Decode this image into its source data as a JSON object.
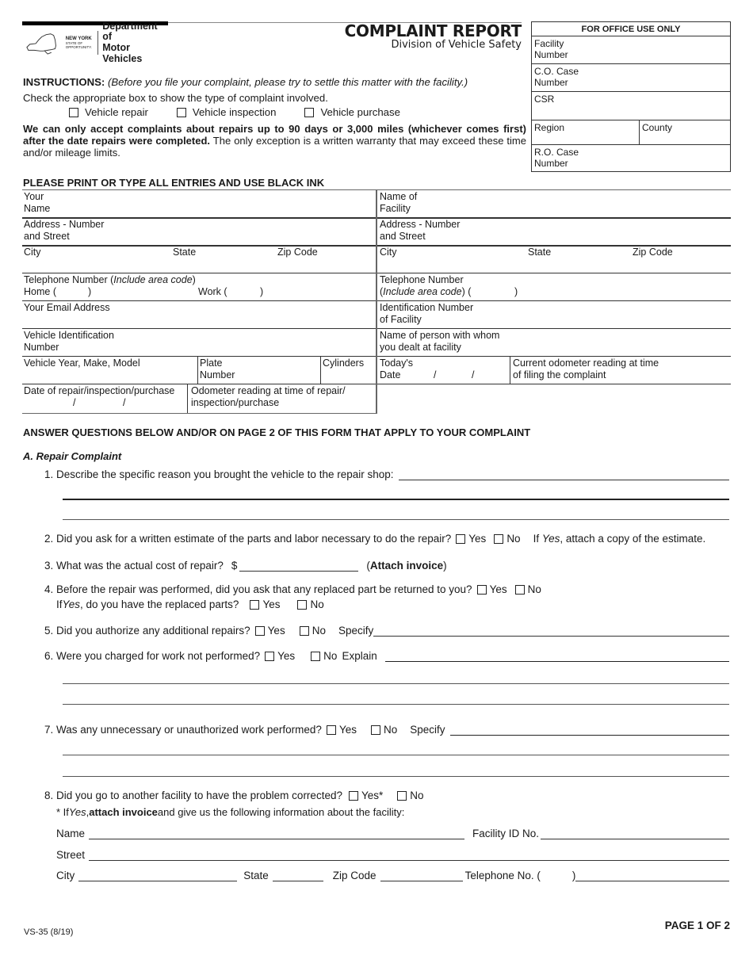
{
  "header": {
    "logo": {
      "state_name": "NEW YORK",
      "state_tagline": "STATE OF OPPORTUNITY.",
      "dept_line1": "Department of",
      "dept_line2": "Motor Vehicles"
    },
    "title": "COMPLAINT REPORT",
    "subtitle": "Division of Vehicle Safety"
  },
  "office_use": {
    "heading": "FOR OFFICE USE ONLY",
    "facility_number_1": "Facility",
    "facility_number_2": "Number",
    "co_case_1": "C.O. Case",
    "co_case_2": "Number",
    "csr": "CSR",
    "region": "Region",
    "county": "County",
    "ro_case_1": "R.O. Case",
    "ro_case_2": "Number"
  },
  "instructions": {
    "label": "INSTRUCTIONS:",
    "note": "(Before you file your complaint, please try to settle this matter with the facility.)",
    "check_prompt": "Check the appropriate box to show the type of complaint involved.",
    "complaint_types": [
      "Vehicle repair",
      "Vehicle inspection",
      "Vehicle purchase"
    ],
    "limits_bold": "We can only accept complaints about repairs up to 90 days or 3,000 miles (whichever comes first) after the date repairs were completed.",
    "limits_rest": " The only exception is a written warranty that may exceed these time and/or mileage limits."
  },
  "form": {
    "print_notice": "PLEASE PRINT OR TYPE ALL ENTRIES AND USE BLACK INK",
    "left": {
      "your_name_1": "Your",
      "your_name_2": "Name",
      "address_1": "Address - Number",
      "address_2": "and Street",
      "city": "City",
      "state": "State",
      "zip": "Zip Code",
      "phone_1": "Telephone Number (",
      "phone_italic": "Include area code",
      "phone_end": ")",
      "home": "Home (",
      "home_close": ")",
      "work": "Work (",
      "work_close": ")",
      "email": "Your Email Address",
      "vin_1": "Vehicle Identification",
      "vin_2": "Number",
      "vehicle_ymm": "Vehicle Year, Make, Model",
      "plate_1": "Plate",
      "plate_2": "Number",
      "cylinders": "Cylinders",
      "date_repair": "Date of repair/inspection/purchase",
      "date_sep": "/",
      "odometer_1": "Odometer reading at time of repair/",
      "odometer_2": "inspection/purchase"
    },
    "right": {
      "facility_name_1": "Name of",
      "facility_name_2": "Facility",
      "address_1": "Address - Number",
      "address_2": "and Street",
      "city": "City",
      "state": "State",
      "zip": "Zip Code",
      "phone_1": "Telephone Number",
      "phone_italic": "Include area code",
      "phone_paren": ") (",
      "phone_close": ")",
      "id_1": "Identification Number",
      "id_2": "of Facility",
      "person_1": "Name of person with whom",
      "person_2": "you dealt at facility",
      "today_1": "Today's",
      "today_2": "Date",
      "date_sep": "/",
      "current_odo_1": "Current odometer reading at time",
      "current_odo_2": "of filing the complaint"
    }
  },
  "questions": {
    "heading": "ANSWER QUESTIONS BELOW AND/OR ON PAGE 2 OF THIS FORM THAT APPLY TO YOUR COMPLAINT",
    "section_a": "A. Repair Complaint",
    "yes": "Yes",
    "no": "No",
    "q1": "1. Describe the specific reason you brought the vehicle to the repair shop:",
    "q2": "2. Did you ask for a written estimate of the parts and labor necessary to do the repair?",
    "q2_note_pre": "If ",
    "q2_note_yes": "Yes",
    "q2_note_post": ", attach a copy of the estimate.",
    "q3": "3. What was the actual cost of repair?",
    "q3_currency": "$",
    "q3_attach_open": "(",
    "q3_attach": "Attach invoice",
    "q3_attach_close": ")",
    "q4": "4. Before the repair was performed, did you ask that any replaced part be returned to you?",
    "q4b_pre": "If ",
    "q4b_yes": "Yes",
    "q4b_post": ", do you have the replaced parts?",
    "q5": "5. Did you authorize any additional repairs?",
    "q5_specify": "Specify",
    "q6": "6. Were you charged for work not performed?",
    "q6_explain": "Explain",
    "q7": "7. Was any unnecessary or unauthorized work performed?",
    "q7_specify": "Specify",
    "q8": "8. Did you go to another facility to have the problem corrected?",
    "q8_yes": "Yes*",
    "q8_note_pre": "* If ",
    "q8_note_yes": "Yes",
    "q8_note_mid": ", ",
    "q8_note_bold": "attach invoice",
    "q8_note_post": " and give us the following information about the facility:",
    "fac_name": "Name",
    "fac_id": "Facility ID No.",
    "fac_street": "Street",
    "fac_city": "City",
    "fac_state": "State",
    "fac_zip": "Zip Code",
    "fac_phone": "Telephone No. (",
    "fac_phone_close": ")"
  },
  "footer": {
    "form_code": "VS-35 (8/19)",
    "page": "PAGE 1 OF 2"
  }
}
